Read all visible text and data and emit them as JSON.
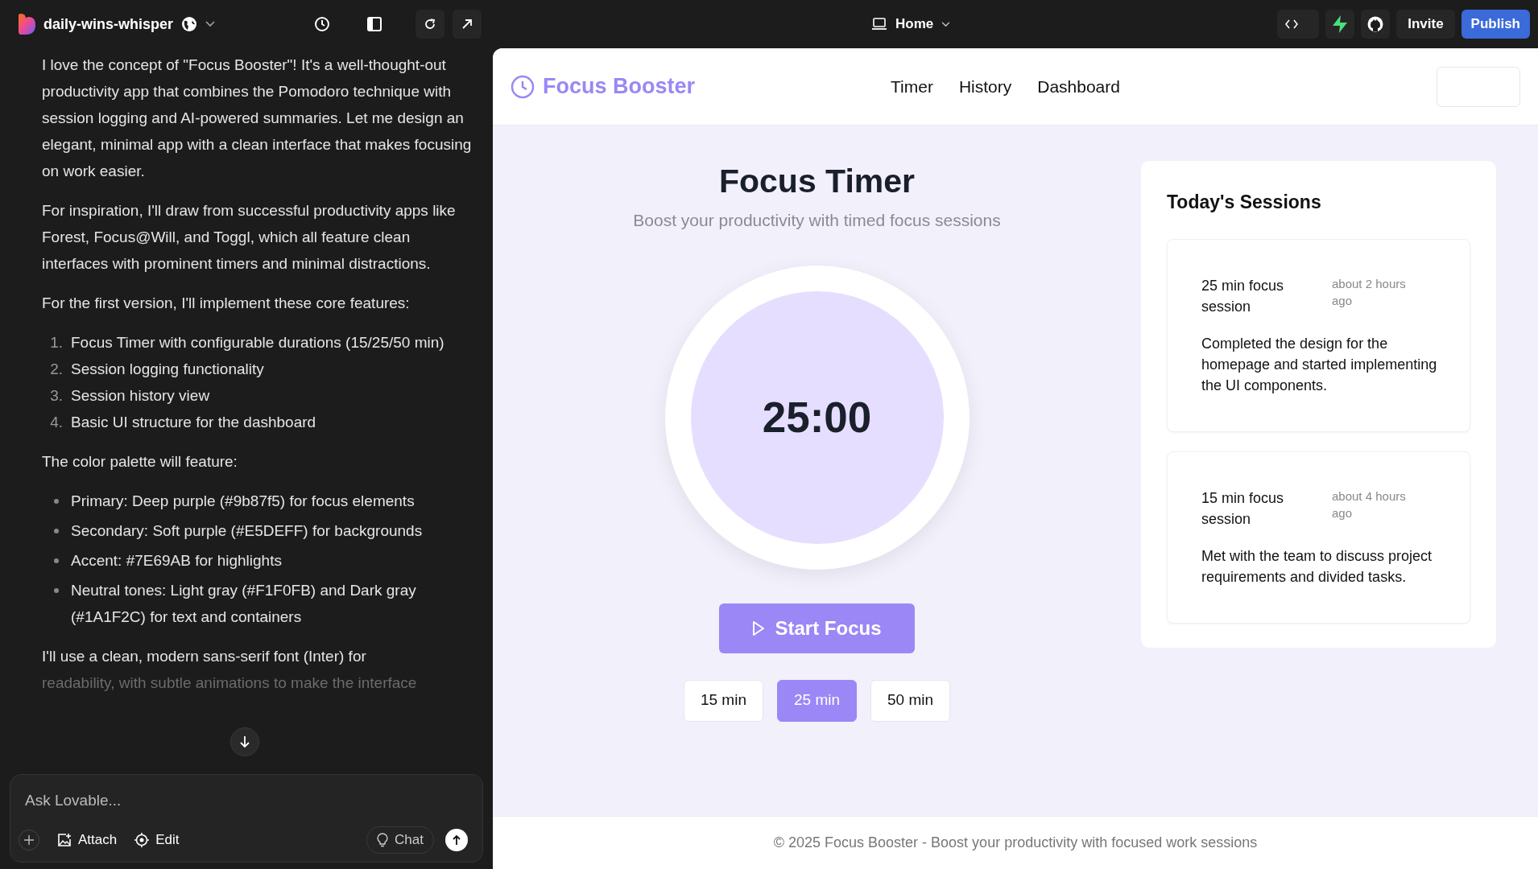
{
  "topbar": {
    "project": "daily-wins-whisper",
    "page": "Home",
    "invite": "Invite",
    "publish": "Publish"
  },
  "chat": {
    "blocks": [
      {
        "kind": "paragraph",
        "text": "I love the concept of \"Focus Booster\"! It's a well-thought-out productivity app that combines the Pomodoro technique with session logging and AI-powered summaries. Let me design an elegant, minimal app with a clean interface that makes focusing on work easier."
      },
      {
        "kind": "paragraph",
        "text": "For inspiration, I'll draw from successful productivity apps like Forest, Focus@Will, and Toggl, which all feature clean interfaces with prominent timers and minimal distractions."
      },
      {
        "kind": "paragraph",
        "text": "For the first version, I'll implement these core features:"
      },
      {
        "kind": "ordered",
        "items": [
          {
            "number": "1.",
            "text": "Focus Timer with configurable durations (15/25/50 min)"
          },
          {
            "number": "2.",
            "text": "Session logging functionality"
          },
          {
            "number": "3.",
            "text": "Session history view"
          },
          {
            "number": "4.",
            "text": "Basic UI structure for the dashboard"
          }
        ]
      },
      {
        "kind": "paragraph",
        "text": "The color palette will feature:"
      },
      {
        "kind": "bulleted",
        "items": [
          {
            "text": "Primary: Deep purple (#9b87f5) for focus elements"
          },
          {
            "text": "Secondary: Soft purple (#E5DEFF) for backgrounds"
          },
          {
            "text": "Accent: #7E69AB for highlights"
          },
          {
            "text": "Neutral tones: Light gray (#F1F0FB) and Dark gray (#1A1F2C) for text and containers"
          }
        ]
      },
      {
        "kind": "fading",
        "lines": [
          "I'll use a clean, modern sans-serif font (Inter) for",
          "readability, with subtle animations to make the interface"
        ]
      }
    ],
    "input": {
      "placeholder": "Ask Lovable...",
      "attach": "Attach",
      "edit": "Edit",
      "mode": "Chat"
    }
  },
  "preview": {
    "brand": "Focus Booster",
    "nav": [
      {
        "label": "Timer"
      },
      {
        "label": "History"
      },
      {
        "label": "Dashboard"
      }
    ],
    "title": "Focus Timer",
    "subtitle": "Boost your productivity with timed focus sessions",
    "time": "25:00",
    "start": "Start Focus",
    "durations": [
      {
        "label": "15 min",
        "selected": false
      },
      {
        "label": "25 min",
        "selected": true
      },
      {
        "label": "50 min",
        "selected": false
      }
    ],
    "sessions_title": "Today's Sessions",
    "sessions": [
      {
        "title": "25 min focus session",
        "time": "about 2 hours ago",
        "note": "Completed the design for the homepage and started implementing the UI components."
      },
      {
        "title": "15 min focus session",
        "time": "about 4 hours ago",
        "note": "Met with the team to discuss project requirements and divided tasks."
      }
    ],
    "footer": "© 2025 Focus Booster - Boost your productivity with focused work sessions"
  }
}
